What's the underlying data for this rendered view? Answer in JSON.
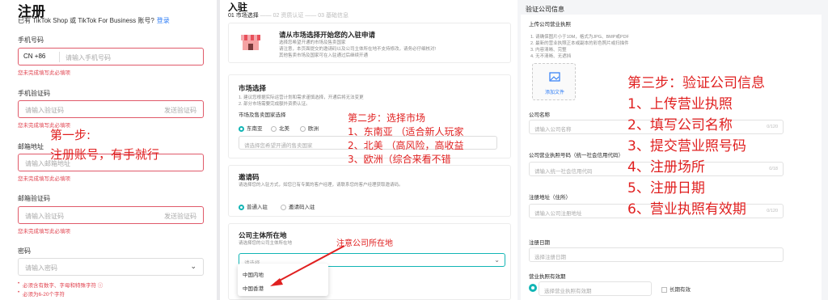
{
  "panel1": {
    "title": "注册",
    "subtitle": "已有 TikTok Shop 或 TikTok For Business 账号?",
    "login_link": "登录",
    "phone": {
      "label": "手机号码",
      "country_code": "CN +86",
      "placeholder": "请输入手机号码",
      "error": "您未完成填写此必填项"
    },
    "phone_code": {
      "label": "手机验证码",
      "placeholder": "请输入验证码",
      "action": "发送验证码",
      "error": "您未完成填写此必填项"
    },
    "email": {
      "label": "邮箱地址",
      "placeholder": "请输入邮箱地址",
      "error": "您未完成填写此必填项"
    },
    "email_code": {
      "label": "邮箱验证码",
      "placeholder": "请输入验证码",
      "action": "发送验证码",
      "error": "您未完成填写此必填项"
    },
    "password": {
      "label": "密码",
      "placeholder": "请输入密码",
      "hints": [
        "必须含有数字、字母和特殊字符 ⓘ",
        "必须为6-20个字符"
      ]
    },
    "annotation": {
      "line1": "第一步:",
      "line2": "注册账号，有手就行"
    }
  },
  "panel2": {
    "title": "入驻",
    "steps": [
      "01 市场选择",
      "02 资质认证",
      "03 基础信息"
    ],
    "intro": {
      "title": "请从市场选择开始您的入驻申请",
      "lines": [
        "选择您希望开通的市场及售卖国家",
        "请注意，本页面提交的邀请码以及公司主体所在地不支持修改，请务必仔细核对!",
        "其他售卖市场及国家可在入驻通过后继续开通"
      ]
    },
    "market": {
      "title": "市场选择",
      "notes": [
        "1. 建议您根据实际运营计划和需求谨慎选择，开通后将无法变更",
        "2. 部分市场需要完成额外资质认证。"
      ],
      "country_label": "市场及售卖国家选择",
      "options": [
        "东南亚",
        "北美",
        "欧洲"
      ],
      "selected": "东南亚",
      "select_placeholder": "请选择您希望开通的售卖国家"
    },
    "invite": {
      "title": "邀请码",
      "desc": "请选择您的入驻方式，如您已有专属的客户经理，请联系您的客户经理获取邀请码。",
      "options": [
        "普通入驻",
        "邀请码入驻"
      ],
      "selected": "普通入驻"
    },
    "company_location": {
      "title": "公司主体所在地",
      "desc": "请选择您的公司主体所在地",
      "placeholder": "请选择",
      "options": [
        "中国内地",
        "中国香港"
      ]
    },
    "annotation": {
      "line1": "第二步：选择市场",
      "line2": "1、东南亚  （适合新人玩家",
      "line3": "2、北美   （高风险，高收益",
      "line4": "3、欧洲（综合来看不错",
      "arrow_note": "注意公司所在地"
    }
  },
  "panel3": {
    "title": "验证公司信息",
    "license_upload": {
      "label": "上传公司营业执照",
      "notes": [
        "1. 请确保图片小于10M，格式为JPG、BMP或PDF",
        "2. 最新的营业执照正本或副本的彩色照片或扫描件",
        "3. 内容清晰、完整",
        "4. 无不清晰、无遮挡"
      ],
      "upload_button": "添加文件"
    },
    "company_name": {
      "label": "公司名称",
      "placeholder": "请输入公司名称",
      "counter": "0/120"
    },
    "license_number": {
      "label": "公司营业执照号码（统一社会信用代码）",
      "placeholder": "请输入统一社会信用代码",
      "counter": "0/18"
    },
    "registered_address": {
      "label": "注册地址（住所）",
      "placeholder": "请输入公司注册地址",
      "counter": "0/120"
    },
    "registration_date": {
      "label": "注册日期",
      "placeholder": "选择注册日期"
    },
    "validity": {
      "label": "营业执照有效期",
      "placeholder": "选择营业执照有效期",
      "long_term": "长期有效"
    },
    "annotation": {
      "title": "第三步：验证公司信息",
      "items": [
        "1、上传营业执照",
        "2、填写公司名称",
        "3、提交营业照号码",
        "4、注册场所",
        "5、注册日期",
        "6、营业执照有效期"
      ]
    }
  },
  "colors": {
    "accent": "#12b5b5",
    "error": "#e0424e",
    "annotation": "#e02020",
    "link": "#2d7cf6"
  }
}
